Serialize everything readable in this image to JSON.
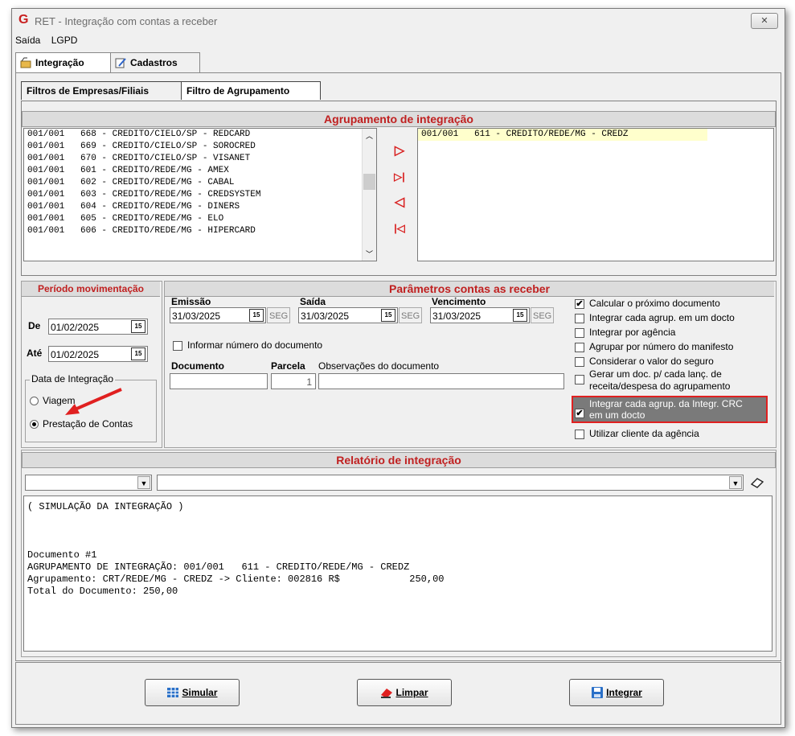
{
  "window": {
    "title": "RET - Integração com contas a receber",
    "close_glyph": "✕"
  },
  "menu": [
    {
      "label": "Saída"
    },
    {
      "label": "LGPD"
    }
  ],
  "tabs": [
    {
      "label": "Integração"
    },
    {
      "label": "Cadastros"
    }
  ],
  "subtabs": [
    {
      "label": "Filtros de Empresas/Filiais"
    },
    {
      "label": "Filtro de Agrupamento"
    }
  ],
  "agrupamento": {
    "header": "Agrupamento de integração",
    "available": [
      "001/001   668 - CREDITO/CIELO/SP - REDCARD",
      "001/001   669 - CREDITO/CIELO/SP - SOROCRED",
      "001/001   670 - CREDITO/CIELO/SP - VISANET",
      "001/001   601 - CREDITO/REDE/MG - AMEX",
      "001/001   602 - CREDITO/REDE/MG - CABAL",
      "001/001   603 - CREDITO/REDE/MG - CREDSYSTEM",
      "001/001   604 - CREDITO/REDE/MG - DINERS",
      "001/001   605 - CREDITO/REDE/MG - ELO",
      "001/001   606 - CREDITO/REDE/MG - HIPERCARD"
    ],
    "selected": [
      "001/001   611 - CREDITO/REDE/MG - CREDZ"
    ],
    "move_icons": [
      "▷",
      "▷|",
      "◁",
      "|◁"
    ]
  },
  "periodo": {
    "header": "Período movimentação",
    "de_label": "De",
    "de_value": "01/02/2025",
    "ate_label": "Até",
    "ate_value": "01/02/2025",
    "cal_glyph": "15",
    "data_integracao_label": "Data de Integração",
    "radio_viagem": "Viagem",
    "radio_prestacao": "Prestação de Contas"
  },
  "parametros": {
    "header": "Parâmetros contas as receber",
    "emissao_label": "Emissão",
    "emissao_value": "31/03/2025",
    "saida_label": "Saída",
    "saida_value": "31/03/2025",
    "vencimento_label": "Vencimento",
    "vencimento_value": "31/03/2025",
    "seg_label": "SEG",
    "informar_label": "Informar número do documento",
    "documento_label": "Documento",
    "parcela_label": "Parcela",
    "parcela_value": "1",
    "obs_label": "Observações do documento",
    "options": [
      {
        "label": "Calcular o próximo documento",
        "checked": true
      },
      {
        "label": "Integrar cada agrup. em um docto",
        "checked": false
      },
      {
        "label": "Integrar por agência",
        "checked": false
      },
      {
        "label": "Agrupar por número do manifesto",
        "checked": false
      },
      {
        "label": "Considerar o valor do seguro",
        "checked": false
      },
      {
        "label": "Gerar um doc. p/ cada lanç. de",
        "label2": "receita/despesa  do agrupamento",
        "checked": false
      },
      {
        "label": "Integrar cada agrup. da Integr. CRC",
        "label2": "em um docto",
        "checked": true
      },
      {
        "label": "Utilizar cliente da agência",
        "checked": false
      }
    ],
    "check_glyph": "✔"
  },
  "relatorio": {
    "header": "Relatório de integração",
    "lines": [
      "( SIMULAÇÃO DA INTEGRAÇÃO )",
      "",
      "",
      "",
      "Documento #1",
      "AGRUPAMENTO DE INTEGRAÇÃO: 001/001   611 - CREDITO/REDE/MG - CREDZ",
      "Agrupamento: CRT/REDE/MG - CREDZ -> Cliente: 002816 R$            250,00",
      "Total do Documento: 250,00"
    ]
  },
  "buttons": {
    "simular": "Simular",
    "limpar": "Limpar",
    "integrar": "Integrar"
  },
  "colors": {
    "accent_red": "#c02020",
    "highlight_box": "#e02020",
    "selected_item_bg": "#ffffcc"
  }
}
